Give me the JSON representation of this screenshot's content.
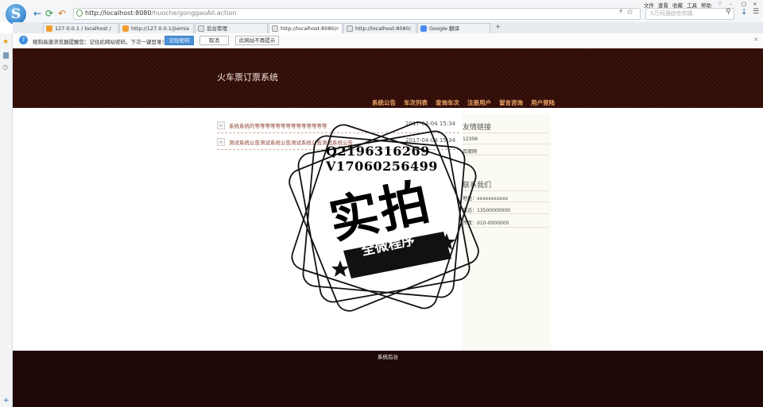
{
  "browser": {
    "menu": [
      "文件",
      "查看",
      "收藏",
      "工具",
      "帮助"
    ],
    "address": {
      "host": "http://localhost:8080",
      "path": "/huoche/gonggaoAll.action"
    },
    "search_placeholder": "5万间酒店任你挑",
    "tabs": [
      {
        "label": "127.0.0.1 / localhost /"
      },
      {
        "label": "http://127.0.0.1/jiemia"
      },
      {
        "label": "后台管理"
      },
      {
        "label": "http://localhost:8080/"
      },
      {
        "label": "http://localhost:8080/"
      },
      {
        "label": "Google 翻译"
      }
    ],
    "new_tab": "+"
  },
  "notify": {
    "text": "搜狗高速浏览器提醒您：记住此网站密码，下次一键登录！",
    "remember_label": "记住密码",
    "cancel_label": "取消",
    "never_label": "此网站不再提示",
    "close": "×"
  },
  "site": {
    "title": "火车票订票系统",
    "nav": [
      "系统公告",
      "车次列表",
      "查询车次",
      "注册用户",
      "留言咨询",
      "用户登陆"
    ]
  },
  "notices": [
    {
      "title": "系统系统的等等等等等等等等等等等等等等",
      "date": "2017-04-04 15:34"
    },
    {
      "title": "测试系统公告测试系统公告测试系统公告测试系统公告",
      "date": "2017-04-04 15:34"
    }
  ],
  "sidebar": {
    "links_title": "友情链接",
    "links": [
      "12306",
      "百度网"
    ],
    "contact_title": "联系我们",
    "contact": [
      "地址：xxxxxxxxxxx",
      "电话：13500000000",
      "传真：010-0000000"
    ]
  },
  "footer": {
    "admin_link": "系统后台"
  },
  "watermark": {
    "qq": "Q2196316269",
    "vx": "V17060256499",
    "main": "实拍",
    "sub": "全微程序"
  }
}
